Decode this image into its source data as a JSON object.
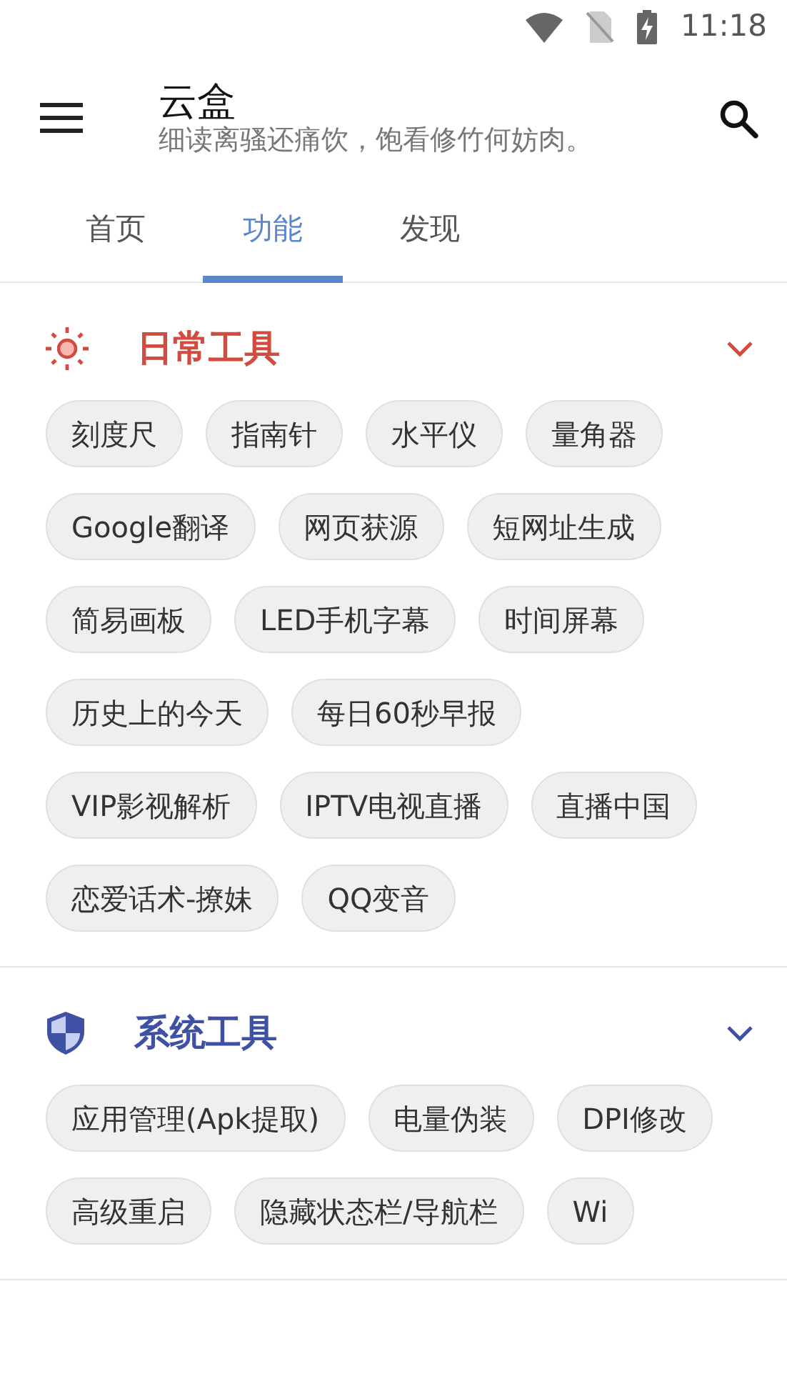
{
  "status_bar": {
    "time": "11:18"
  },
  "app_bar": {
    "title": "云盒",
    "subtitle": "细读离骚还痛饮，饱看修竹何妨肉。"
  },
  "tabs": [
    {
      "label": "首页",
      "selected": false
    },
    {
      "label": "功能",
      "selected": true
    },
    {
      "label": "发现",
      "selected": false
    }
  ],
  "sections": [
    {
      "title": "日常工具",
      "color": "#d14b3e",
      "expanded": true,
      "items": [
        "刻度尺",
        "指南针",
        "水平仪",
        "量角器",
        "Google翻译",
        "网页获源",
        "短网址生成",
        "简易画板",
        "LED手机字幕",
        "时间屏幕",
        "历史上的今天",
        "每日60秒早报",
        "VIP影视解析",
        "IPTV电视直播",
        "直播中国",
        "恋爱话术-撩妹",
        "QQ变音"
      ]
    },
    {
      "title": "系统工具",
      "color": "#3f51a5",
      "expanded": true,
      "items": [
        "应用管理(Apk提取)",
        "电量伪装",
        "DPI修改",
        "高级重启",
        "隐藏状态栏/导航栏",
        "Wi"
      ]
    }
  ]
}
